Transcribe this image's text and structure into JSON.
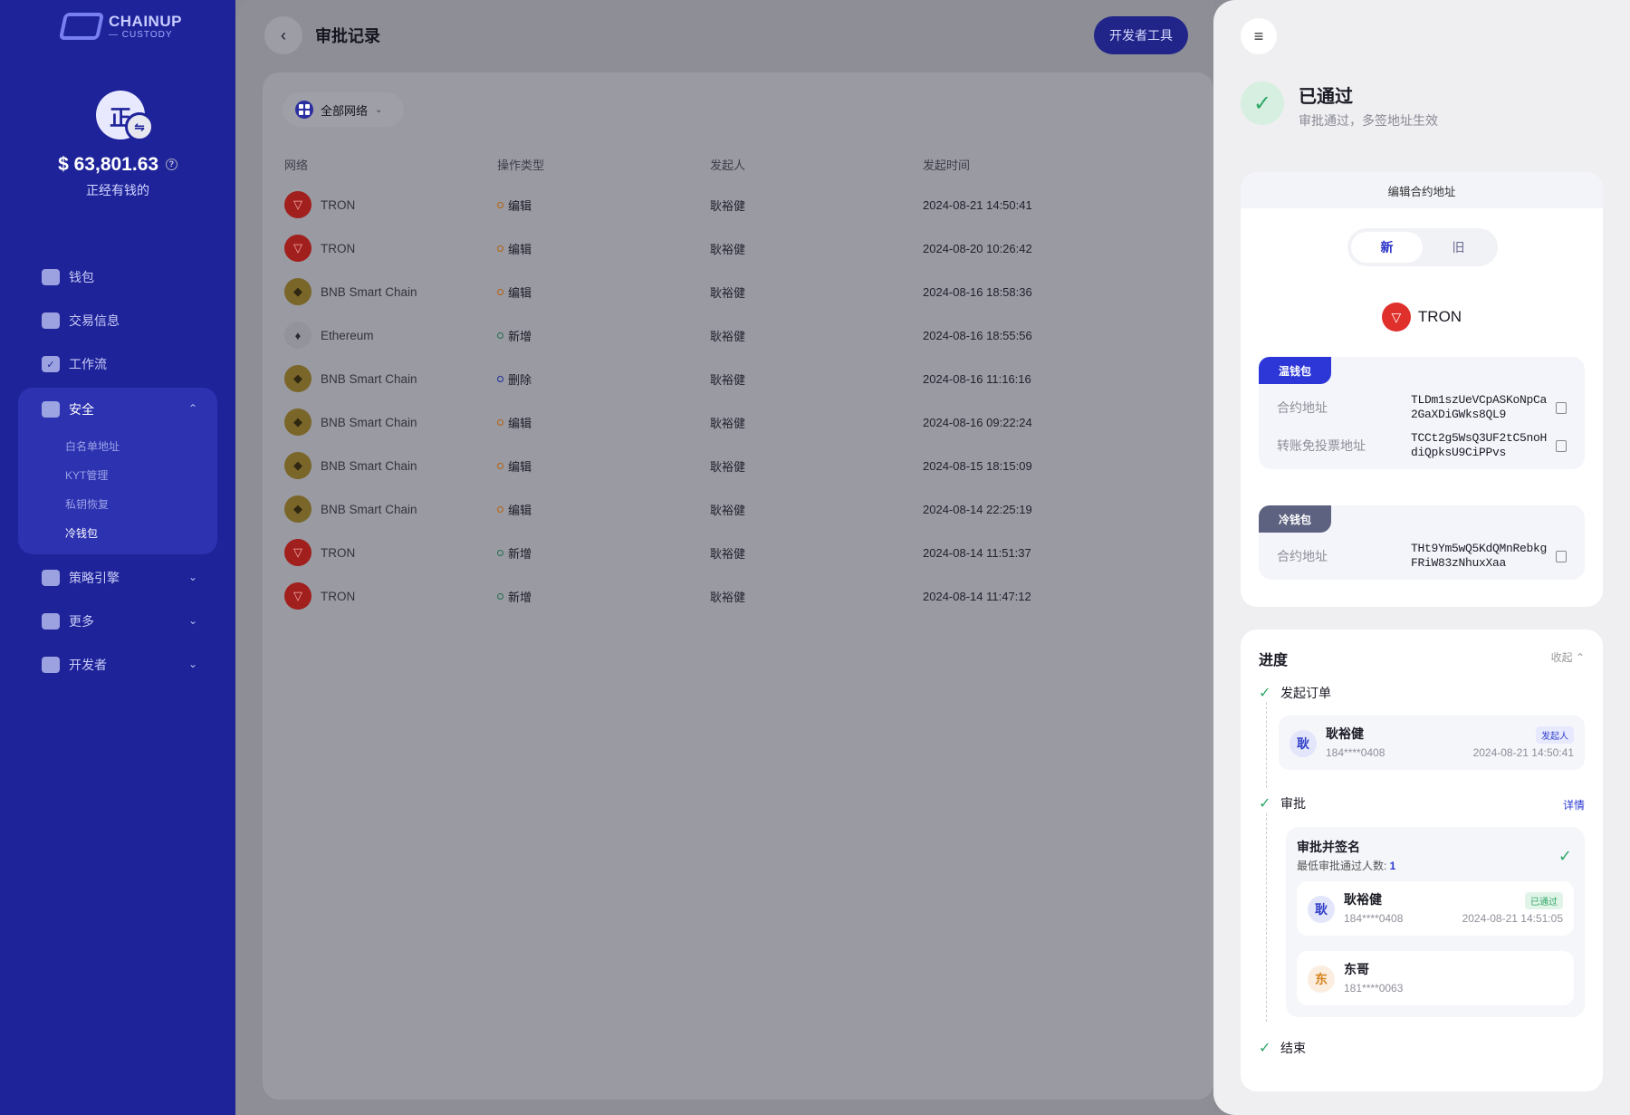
{
  "sidebar": {
    "logo_line1": "CHAINUP",
    "logo_line2": "— CUSTODY",
    "avatar_char": "正",
    "balance": "$ 63,801.63",
    "wallet_name": "正经有钱的",
    "nav": [
      {
        "label": "钱包",
        "icon": "wallet-icon"
      },
      {
        "label": "交易信息",
        "icon": "transaction-icon"
      },
      {
        "label": "工作流",
        "icon": "workflow-icon"
      }
    ],
    "security": {
      "label": "安全",
      "items": [
        "白名单地址",
        "KYT管理",
        "私钥恢复",
        "冷钱包"
      ],
      "active_item": "冷钱包"
    },
    "nav_bottom": [
      {
        "label": "策略引擎",
        "icon": "strategy-icon"
      },
      {
        "label": "更多",
        "icon": "more-icon"
      },
      {
        "label": "开发者",
        "icon": "developer-icon"
      }
    ]
  },
  "main": {
    "title": "审批记录",
    "dev_tools_label": "开发者工具",
    "network_filter": "全部网络",
    "columns": [
      "网络",
      "操作类型",
      "发起人",
      "发起时间"
    ],
    "rows": [
      {
        "network": "TRON",
        "chain": "tron",
        "op": "编辑",
        "op_kind": "edit",
        "initiator": "耿裕健",
        "time": "2024-08-21 14:50:41"
      },
      {
        "network": "TRON",
        "chain": "tron",
        "op": "编辑",
        "op_kind": "edit",
        "initiator": "耿裕健",
        "time": "2024-08-20 10:26:42"
      },
      {
        "network": "BNB Smart Chain",
        "chain": "bnb",
        "op": "编辑",
        "op_kind": "edit",
        "initiator": "耿裕健",
        "time": "2024-08-16 18:58:36"
      },
      {
        "network": "Ethereum",
        "chain": "eth",
        "op": "新增",
        "op_kind": "add",
        "initiator": "耿裕健",
        "time": "2024-08-16 18:55:56"
      },
      {
        "network": "BNB Smart Chain",
        "chain": "bnb",
        "op": "删除",
        "op_kind": "del",
        "initiator": "耿裕健",
        "time": "2024-08-16 11:16:16"
      },
      {
        "network": "BNB Smart Chain",
        "chain": "bnb",
        "op": "编辑",
        "op_kind": "edit",
        "initiator": "耿裕健",
        "time": "2024-08-16 09:22:24"
      },
      {
        "network": "BNB Smart Chain",
        "chain": "bnb",
        "op": "编辑",
        "op_kind": "edit",
        "initiator": "耿裕健",
        "time": "2024-08-15 18:15:09"
      },
      {
        "network": "BNB Smart Chain",
        "chain": "bnb",
        "op": "编辑",
        "op_kind": "edit",
        "initiator": "耿裕健",
        "time": "2024-08-14 22:25:19"
      },
      {
        "network": "TRON",
        "chain": "tron",
        "op": "新增",
        "op_kind": "add",
        "initiator": "耿裕健",
        "time": "2024-08-14 11:51:37"
      },
      {
        "network": "TRON",
        "chain": "tron",
        "op": "新增",
        "op_kind": "add",
        "initiator": "耿裕健",
        "time": "2024-08-14 11:47:12"
      }
    ]
  },
  "drawer": {
    "status_title": "已通过",
    "status_desc": "审批通过，多签地址生效",
    "edit_header": "编辑合约地址",
    "toggle_new": "新",
    "toggle_old": "旧",
    "network": "TRON",
    "hot": {
      "tag": "温钱包",
      "contract_label": "合约地址",
      "contract_value": "TLDm1szUeVCpASKoNpCa2GaXDiGWks8QL9",
      "transfer_label": "转账免投票地址",
      "transfer_value": "TCCt2g5WsQ3UF2tC5noHdiQpksU9CiPPvs"
    },
    "cold": {
      "tag": "冷钱包",
      "contract_label": "合约地址",
      "contract_value": "THt9Ym5wQ5KdQMnRebkgFRiW83zNhuxXaa"
    },
    "progress": {
      "title": "进度",
      "collapse_label": "收起",
      "step1": "发起订单",
      "initiator": {
        "avatar": "耿",
        "name": "耿裕健",
        "phone": "184****0408",
        "badge": "发起人",
        "time": "2024-08-21 14:50:41"
      },
      "step2": "审批",
      "detail_link": "详情",
      "approve_title": "审批并签名",
      "approve_min_label": "最低审批通过人数: ",
      "approve_min_value": "1",
      "approvers": [
        {
          "avatar": "耿",
          "name": "耿裕健",
          "phone": "184****0408",
          "badge": "已通过",
          "time": "2024-08-21 14:51:05"
        },
        {
          "avatar": "东",
          "name": "东哥",
          "phone": "181****0063"
        }
      ],
      "step3": "结束"
    }
  }
}
